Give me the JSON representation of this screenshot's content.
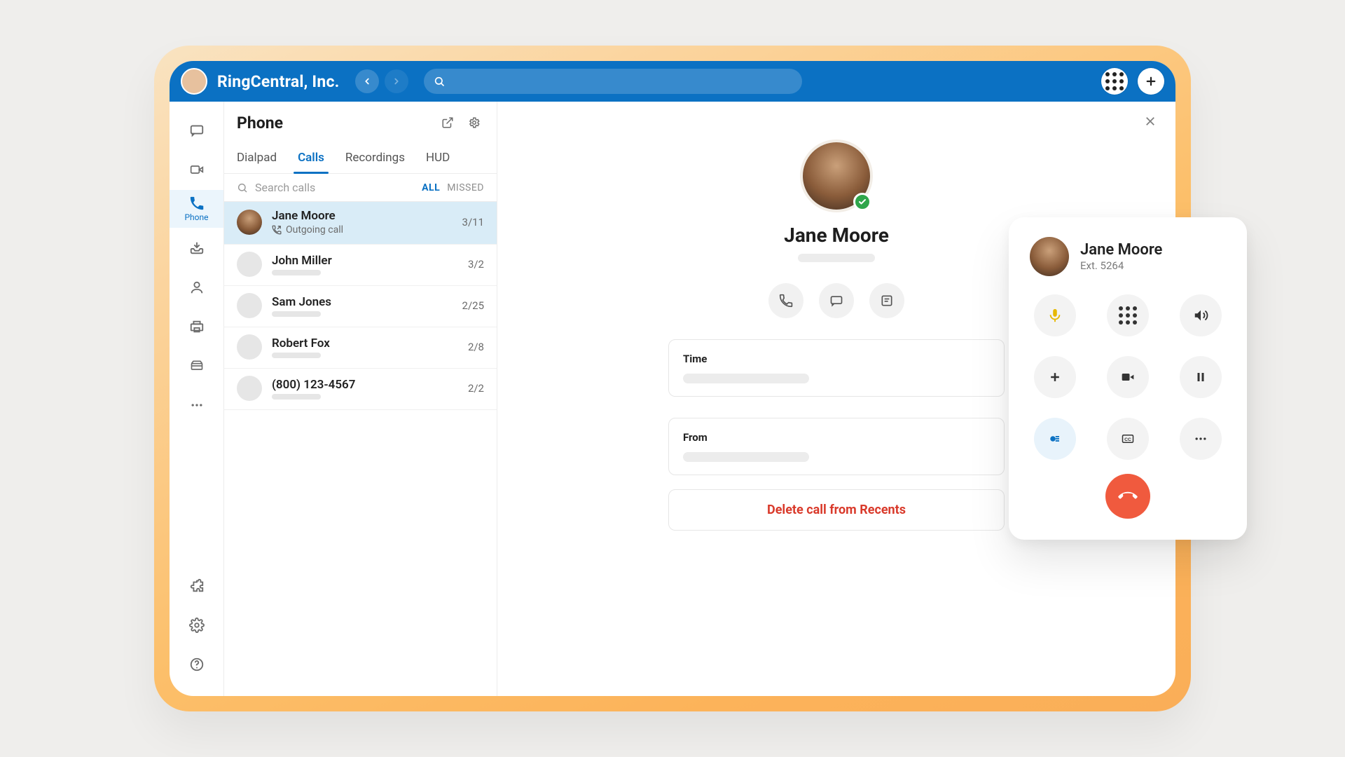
{
  "brand": {
    "name": "RingCentral, Inc."
  },
  "search": {
    "placeholder": ""
  },
  "rail": {
    "active_label": "Phone",
    "items": [
      "chat",
      "video",
      "phone",
      "inbox",
      "contacts",
      "fax",
      "voicemail",
      "more"
    ]
  },
  "phone": {
    "title": "Phone",
    "tabs": {
      "dialpad": "Dialpad",
      "calls": "Calls",
      "recordings": "Recordings",
      "hud": "HUD"
    },
    "active_tab": "calls",
    "search_placeholder": "Search calls",
    "filter_all": "ALL",
    "filter_missed": "MISSED",
    "calls": [
      {
        "name": "Jane Moore",
        "sub": "Outgoing call",
        "date": "3/11",
        "selected": true,
        "has_photo": true
      },
      {
        "name": "John Miller",
        "sub": "",
        "date": "3/2",
        "selected": false,
        "has_photo": false
      },
      {
        "name": "Sam Jones",
        "sub": "",
        "date": "2/25",
        "selected": false,
        "has_photo": false
      },
      {
        "name": "Robert Fox",
        "sub": "",
        "date": "2/8",
        "selected": false,
        "has_photo": false
      },
      {
        "name": "(800) 123-4567",
        "sub": "",
        "date": "2/2",
        "selected": false,
        "has_photo": false
      }
    ]
  },
  "detail": {
    "name": "Jane Moore",
    "time_label": "Time",
    "from_label": "From",
    "delete_label": "Delete call from Recents"
  },
  "call_popper": {
    "name": "Jane Moore",
    "ext": "Ext. 5264",
    "buttons": [
      "mute",
      "dialpad",
      "speaker",
      "add",
      "video",
      "hold",
      "record",
      "cc",
      "more"
    ]
  }
}
